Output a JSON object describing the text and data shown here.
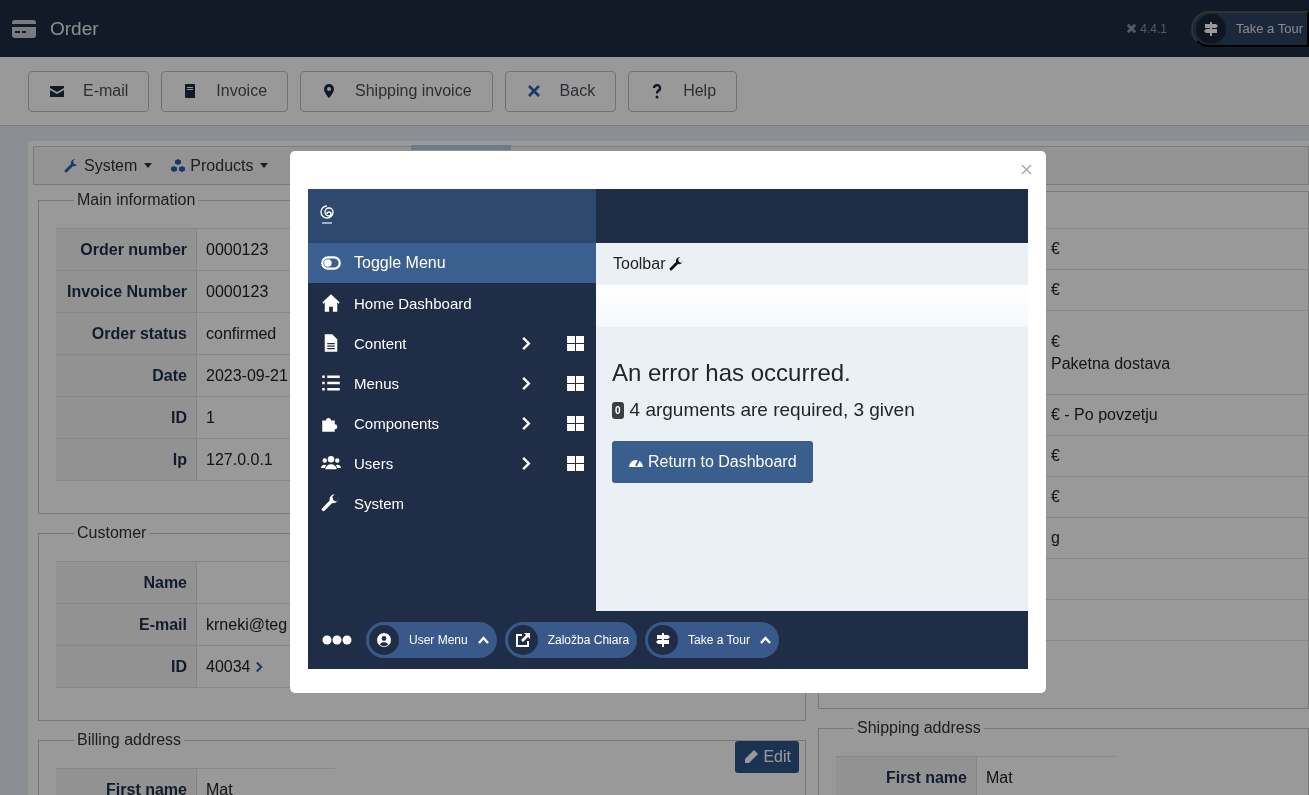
{
  "header": {
    "title": "Order",
    "version": "4.4.1",
    "tour_button": "Take a Tour"
  },
  "toolbar": [
    {
      "label": "E-mail"
    },
    {
      "label": "Invoice"
    },
    {
      "label": "Shipping invoice"
    },
    {
      "label": "Back"
    },
    {
      "label": "Help"
    }
  ],
  "nav": [
    {
      "label": "System"
    },
    {
      "label": "Products"
    }
  ],
  "main_information": {
    "legend": "Main information",
    "rows": [
      {
        "label": "Order number",
        "value": "0000123"
      },
      {
        "label": "Invoice Number",
        "value": "0000123"
      },
      {
        "label": "Order status",
        "value": "confirmed"
      },
      {
        "label": "Date",
        "value": "2023-09-21"
      },
      {
        "label": "ID",
        "value": "1"
      },
      {
        "label": "Ip",
        "value": "127.0.0.1"
      }
    ]
  },
  "customer": {
    "legend": "Customer",
    "rows": [
      {
        "label": "Name"
      },
      {
        "label": "E-mail",
        "value": "krneki@teg"
      },
      {
        "label": "ID",
        "value": "40034",
        "link": true
      }
    ]
  },
  "billing_address": {
    "legend": "Billing address",
    "edit_button": "Edit",
    "rows": [
      {
        "label": "First name",
        "value": "Mat"
      }
    ]
  },
  "right_panel": {
    "rows": [
      {
        "lines": [
          "€"
        ]
      },
      {
        "lines": [
          "€"
        ]
      },
      {
        "lines": [
          "€",
          "Paketna dostava"
        ]
      },
      {
        "lines": [
          "€ - Po povzetju"
        ]
      },
      {
        "lines": [
          "€"
        ]
      },
      {
        "lines": [
          "€"
        ]
      },
      {
        "lines": [
          "g"
        ]
      },
      {},
      {}
    ]
  },
  "shipping_address": {
    "legend": "Shipping address",
    "rows": [
      {
        "label": "First name",
        "value": "Mat"
      }
    ]
  },
  "modal": {
    "sidebar": [
      {
        "label": "Toggle Menu",
        "selected": true,
        "expandable": false
      },
      {
        "label": "Home Dashboard",
        "selected": false,
        "expandable": false
      },
      {
        "label": "Content",
        "selected": false,
        "expandable": true
      },
      {
        "label": "Menus",
        "selected": false,
        "expandable": true
      },
      {
        "label": "Components",
        "selected": false,
        "expandable": true
      },
      {
        "label": "Users",
        "selected": false,
        "expandable": true
      },
      {
        "label": "System",
        "selected": false,
        "expandable": false
      }
    ],
    "toolbar_label": "Toolbar",
    "error_title": "An error has occurred.",
    "error_code": "0",
    "error_message": "4 arguments are required, 3 given",
    "return_button": "Return to Dashboard",
    "footer": [
      {
        "label": "User Menu",
        "caret": true
      },
      {
        "label": "Založba Chiara",
        "caret": false
      },
      {
        "label": "Take a Tour",
        "caret": true
      }
    ]
  }
}
